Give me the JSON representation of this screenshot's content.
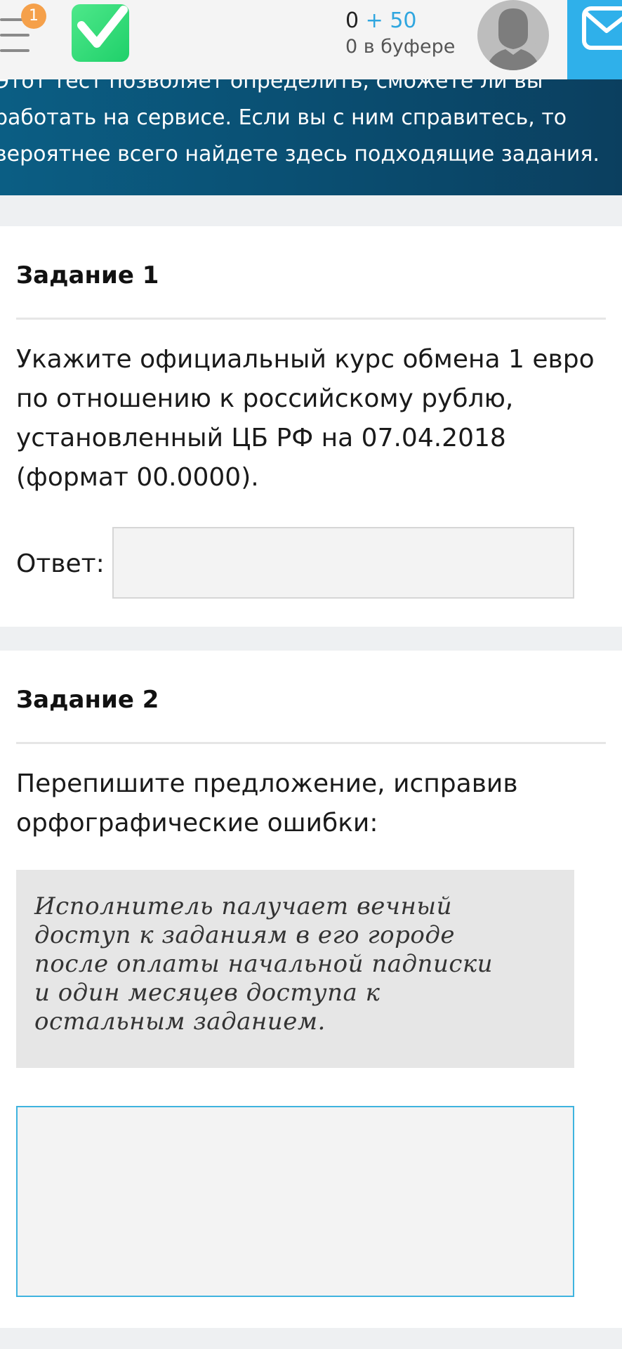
{
  "header": {
    "notification_count": "1",
    "balance_value": "0",
    "balance_bonus": "+ 50",
    "buffer_text": "0 в буфере"
  },
  "banner": {
    "line1": "Этот тест позволяет определить, сможете ли вы",
    "line2": "работать на сервисе. Если вы с ним справитесь, то",
    "line3": "вероятнее всего найдете здесь подходящие задания."
  },
  "task1": {
    "title": "Задание 1",
    "body": "Укажите официальный курс обмена 1 евро по отношению к российскому рублю, установленный ЦБ РФ на 07.04.2018 (формат 00.0000).",
    "answer_label": "Ответ:",
    "answer_value": ""
  },
  "task2": {
    "title": "Задание 2",
    "body": "Перепишите предложение, исправив орфографические ошибки:",
    "sentence_lines": [
      "Исполнитель палучает вечный",
      "доступ к заданиям в его городе",
      "после оплаты начальной падписки",
      "и один месяцев доступа к",
      "остальным заданием."
    ],
    "answer_value": ""
  },
  "colors": {
    "accent": "#2fa6df",
    "banner": "#0a4d70",
    "logo": "#1fd06a",
    "badge": "#f5a04a",
    "mail": "#2fb0ea"
  },
  "icons": {
    "menu": "hamburger-menu-icon",
    "logo": "checkmark-logo-icon",
    "avatar": "user-avatar-icon",
    "mail": "mail-icon"
  }
}
